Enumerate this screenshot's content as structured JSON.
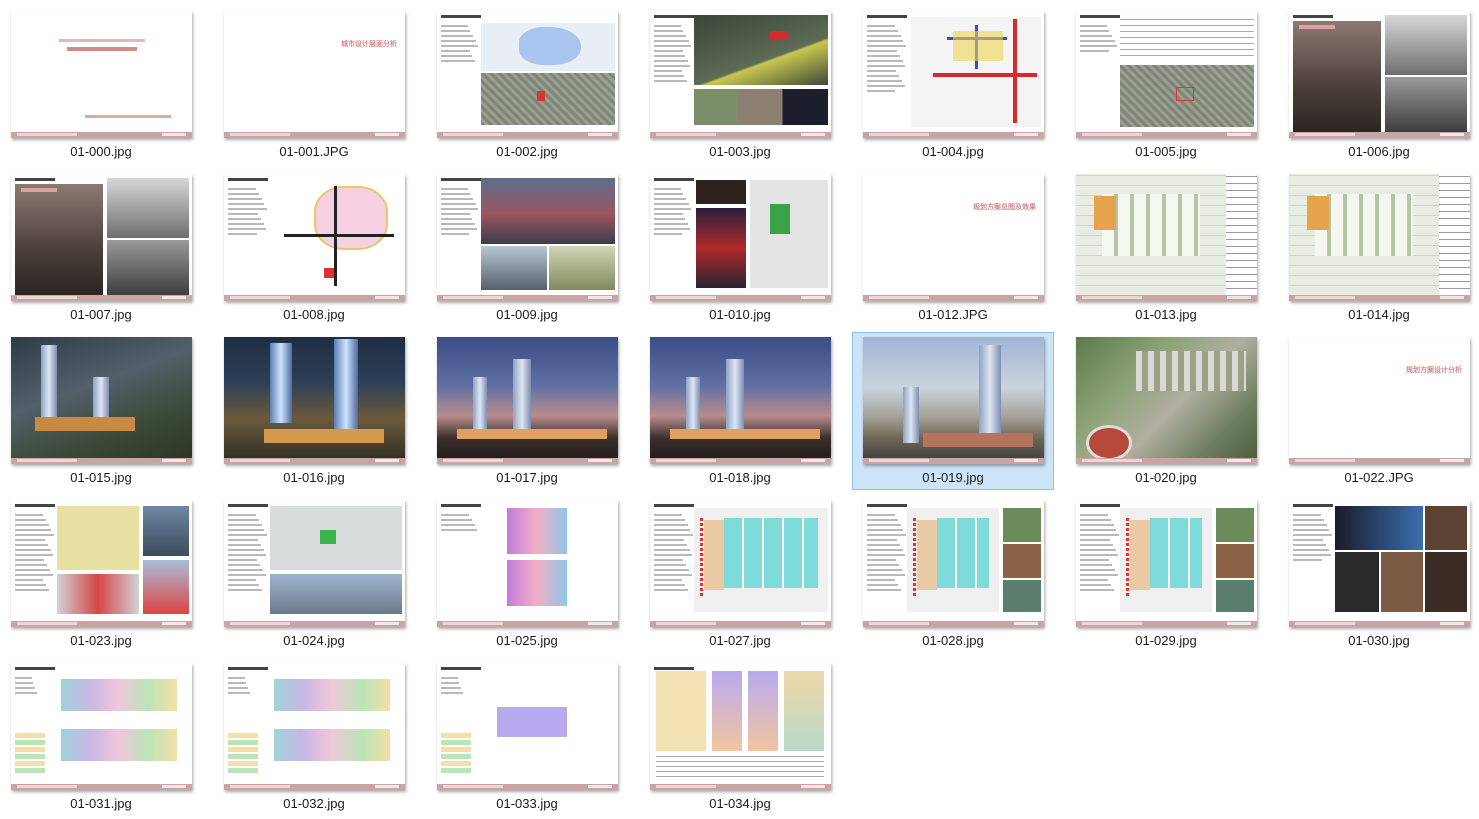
{
  "files": [
    {
      "name": "01-000.jpg",
      "kind": "cover",
      "selected": false
    },
    {
      "name": "01-001.JPG",
      "kind": "section",
      "section_title": "城市设计层面分析",
      "selected": false
    },
    {
      "name": "01-002.jpg",
      "kind": "map",
      "selected": false
    },
    {
      "name": "01-003.jpg",
      "kind": "model",
      "selected": false
    },
    {
      "name": "01-004.jpg",
      "kind": "roads",
      "selected": false
    },
    {
      "name": "01-005.jpg",
      "kind": "table-map",
      "selected": false
    },
    {
      "name": "01-006.jpg",
      "kind": "photos-bw",
      "selected": false
    },
    {
      "name": "01-007.jpg",
      "kind": "photos-bw",
      "selected": false
    },
    {
      "name": "01-008.jpg",
      "kind": "diagram",
      "selected": false
    },
    {
      "name": "01-009.jpg",
      "kind": "photos-city",
      "selected": false
    },
    {
      "name": "01-010.jpg",
      "kind": "photos-night",
      "selected": false
    },
    {
      "name": "01-012.JPG",
      "kind": "section",
      "section_title": "规划方案总图及效果",
      "selected": false
    },
    {
      "name": "01-013.jpg",
      "kind": "siteplan",
      "selected": false
    },
    {
      "name": "01-014.jpg",
      "kind": "siteplan",
      "selected": false
    },
    {
      "name": "01-015.jpg",
      "kind": "render-aerial-night",
      "selected": false
    },
    {
      "name": "01-016.jpg",
      "kind": "render-night",
      "selected": false
    },
    {
      "name": "01-017.jpg",
      "kind": "render-dusk",
      "selected": false
    },
    {
      "name": "01-018.jpg",
      "kind": "render-dusk",
      "selected": false
    },
    {
      "name": "01-019.jpg",
      "kind": "render-day",
      "selected": true
    },
    {
      "name": "01-020.jpg",
      "kind": "render-aerial",
      "selected": false
    },
    {
      "name": "01-022.JPG",
      "kind": "section",
      "section_title": "规划方案设计分析",
      "selected": false
    },
    {
      "name": "01-023.jpg",
      "kind": "analysis",
      "selected": false
    },
    {
      "name": "01-024.jpg",
      "kind": "analysis-3d",
      "selected": false
    },
    {
      "name": "01-025.jpg",
      "kind": "analysis-colors",
      "selected": false
    },
    {
      "name": "01-027.jpg",
      "kind": "plan-colors",
      "selected": false
    },
    {
      "name": "01-028.jpg",
      "kind": "plan-colors-photos",
      "selected": false
    },
    {
      "name": "01-029.jpg",
      "kind": "plan-colors-photos",
      "selected": false
    },
    {
      "name": "01-030.jpg",
      "kind": "photos-mall",
      "selected": false
    },
    {
      "name": "01-031.jpg",
      "kind": "floorplan",
      "selected": false
    },
    {
      "name": "01-032.jpg",
      "kind": "floorplan",
      "selected": false
    },
    {
      "name": "01-033.jpg",
      "kind": "floorplan-small",
      "selected": false
    },
    {
      "name": "01-034.jpg",
      "kind": "drawings",
      "selected": false
    }
  ],
  "colors": {
    "selection_bg": "#cce4f7",
    "selection_border": "#8dbfe8",
    "accent_pink": "#d28b8b",
    "footer": "#c9a4a4"
  }
}
